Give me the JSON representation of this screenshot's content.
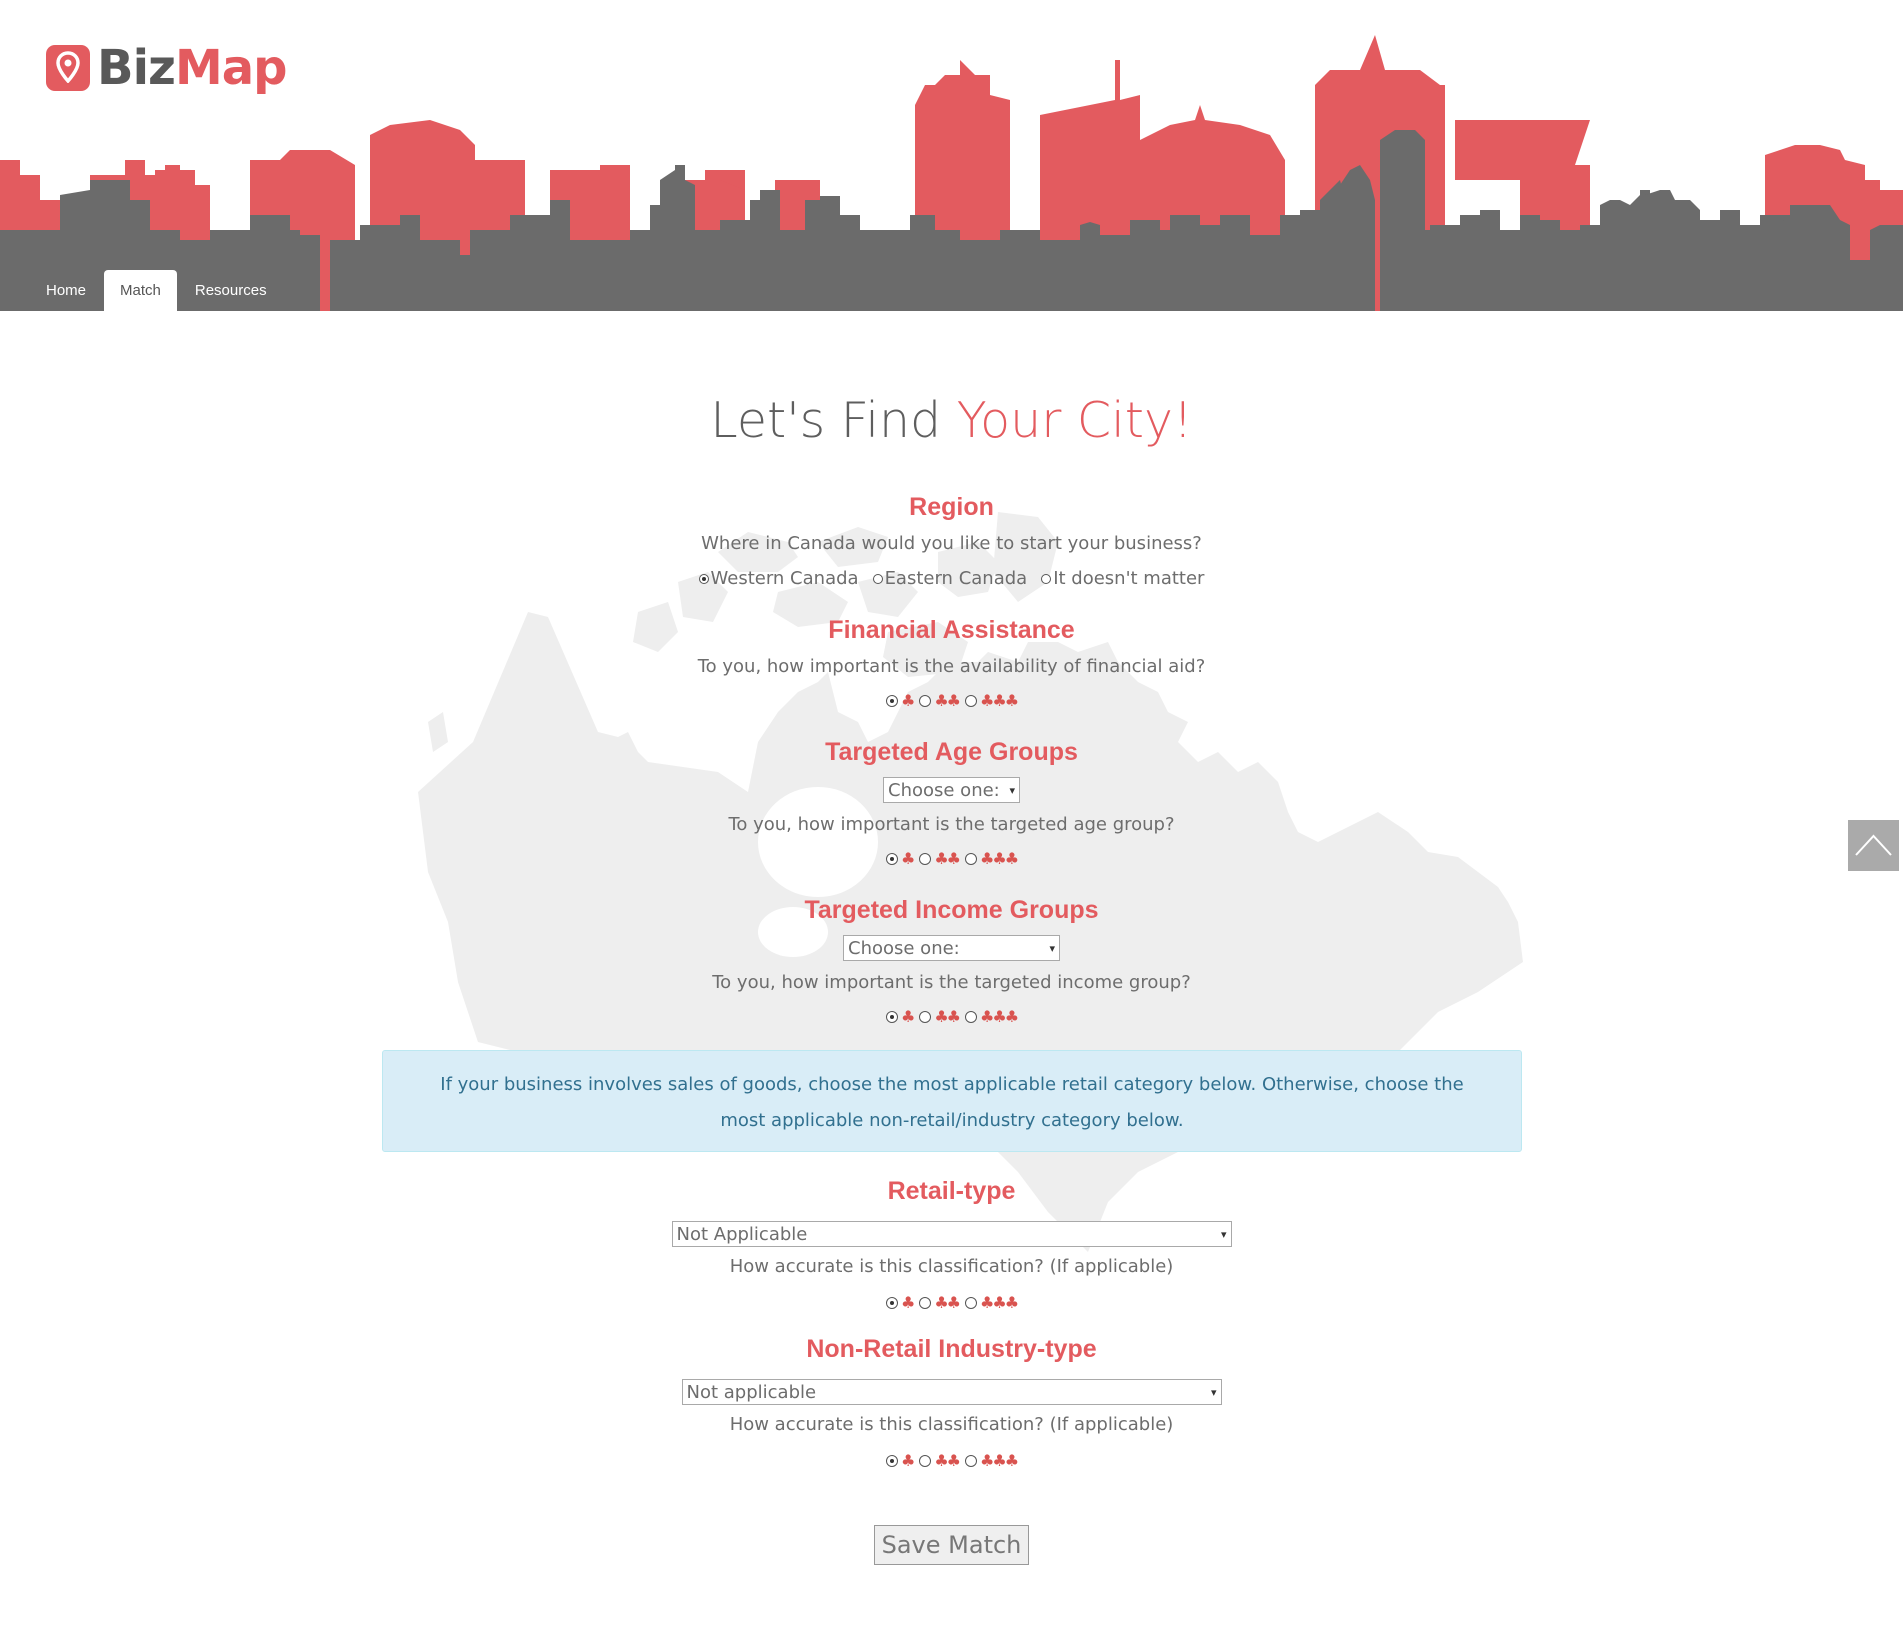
{
  "brand": {
    "name_part1": "Biz",
    "name_part2": "Map",
    "accent_color": "#e35b5f",
    "skyline_dark": "#6b6b6b"
  },
  "nav": {
    "tabs": [
      {
        "label": "Home",
        "active": false
      },
      {
        "label": "Match",
        "active": true
      },
      {
        "label": "Resources",
        "active": false
      }
    ]
  },
  "page": {
    "title_part1": "Let's Find ",
    "title_part2": "Your City!"
  },
  "region": {
    "heading": "Region",
    "question": "Where in Canada would you like to start your business?",
    "options": [
      "Western Canada",
      "Eastern Canada",
      "It doesn't matter"
    ],
    "selected_index": 0
  },
  "financial": {
    "heading": "Financial Assistance",
    "question": "To you, how important is the availability of financial aid?",
    "rating": 1
  },
  "age": {
    "heading": "Targeted Age Groups",
    "select_value": "Choose one:",
    "question": "To you, how important is the targeted age group?",
    "rating": 1
  },
  "income": {
    "heading": "Targeted Income Groups",
    "select_value": "Choose one:",
    "question": "To you, how important is the targeted income group?",
    "rating": 1
  },
  "info": {
    "text": "If your business involves sales of goods, choose the most applicable retail category below. Otherwise, choose the most applicable non-retail/industry category below."
  },
  "retail": {
    "heading": "Retail-type",
    "select_value": "Not Applicable",
    "question": "How accurate is this classification? (If applicable)",
    "rating": 1
  },
  "nonretail": {
    "heading": "Non-Retail Industry-type",
    "select_value": "Not applicable",
    "question": "How accurate is this classification? (If applicable)",
    "rating": 1
  },
  "actions": {
    "save_label": "Save Match"
  },
  "icons": {
    "rating_leaf": "maple-leaf-icon",
    "scroll_top": "chevron-up-icon",
    "logo": "map-pin-icon"
  }
}
